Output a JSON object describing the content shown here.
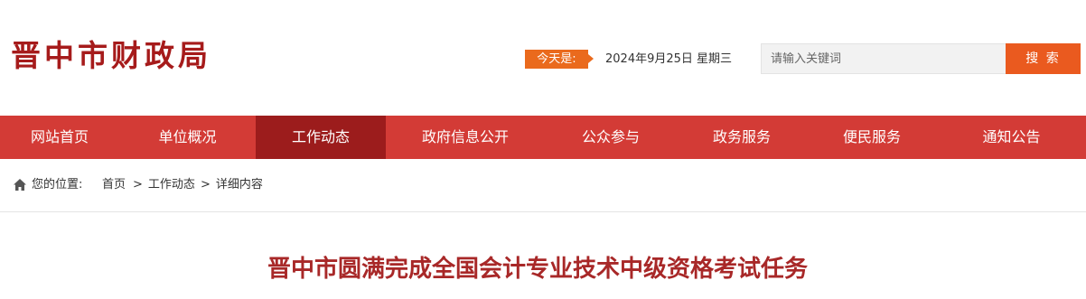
{
  "header": {
    "logo_text": "晋中市财政局",
    "today_label": "今天是:",
    "date": "2024年9月25日 星期三",
    "search": {
      "placeholder": "请输入关键词",
      "button_label": "搜 索"
    }
  },
  "nav": {
    "active_index": 2,
    "items": [
      {
        "label": "网站首页"
      },
      {
        "label": "单位概况"
      },
      {
        "label": "工作动态"
      },
      {
        "label": "政府信息公开"
      },
      {
        "label": "公众参与"
      },
      {
        "label": "政务服务"
      },
      {
        "label": "便民服务"
      },
      {
        "label": "通知公告"
      }
    ]
  },
  "breadcrumb": {
    "label": "您的位置:",
    "items": [
      "首页",
      "工作动态",
      "详细内容"
    ],
    "separator": ">"
  },
  "article": {
    "title": "晋中市圆满完成全国会计专业技术中级资格考试任务"
  },
  "colors": {
    "brand_red": "#a61b1b",
    "nav_red": "#d33b36",
    "nav_active": "#9c1c1c",
    "orange": "#ea5a1f",
    "title_red": "#a82828"
  }
}
